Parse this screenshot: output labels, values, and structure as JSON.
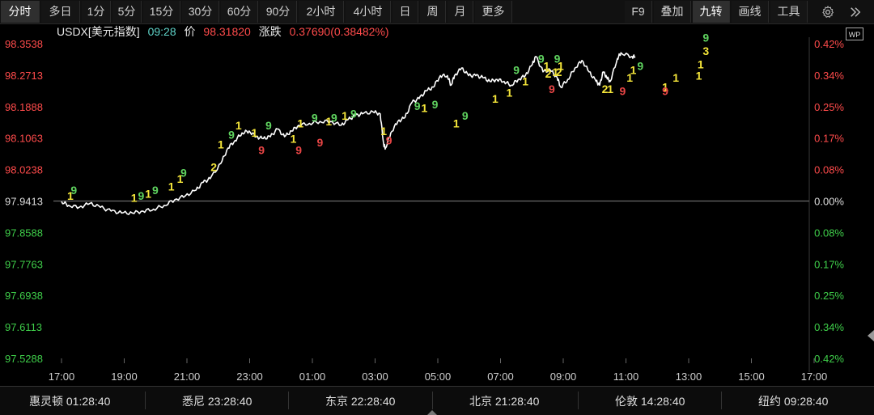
{
  "toolbar": {
    "periods": [
      {
        "label": "分时",
        "active": true
      },
      {
        "label": "多日",
        "active": false
      },
      {
        "label": "1分",
        "active": false
      },
      {
        "label": "5分",
        "active": false
      },
      {
        "label": "15分",
        "active": false
      },
      {
        "label": "30分",
        "active": false
      },
      {
        "label": "60分",
        "active": false
      },
      {
        "label": "90分",
        "active": false
      },
      {
        "label": "2小时",
        "active": false
      },
      {
        "label": "4小时",
        "active": false
      },
      {
        "label": "日",
        "active": false
      },
      {
        "label": "周",
        "active": false
      },
      {
        "label": "月",
        "active": false
      },
      {
        "label": "更多",
        "active": false
      }
    ],
    "tools": [
      {
        "label": "F9",
        "active": false
      },
      {
        "label": "叠加",
        "active": false
      },
      {
        "label": "九转",
        "active": true
      },
      {
        "label": "画线",
        "active": false
      },
      {
        "label": "工具",
        "active": false
      }
    ],
    "settings_icon": "gear-icon",
    "expand_icon": "double-chevron-right-icon"
  },
  "info": {
    "symbol": "USDX[美元指数]",
    "time": "09:28",
    "price_label": "价",
    "price": "98.31820",
    "change_label": "涨跌",
    "change": "0.37690(0.38482%)",
    "wp_badge": "WP"
  },
  "colors": {
    "up": "#ff3b30",
    "down": "#3fcf4a",
    "line": "#ffffff",
    "nine_yellow": "#f5e63a",
    "nine_green": "#5fd35f",
    "nine_red": "#e84545",
    "base": "#6a6a6a"
  },
  "chart_data": {
    "type": "line",
    "title": "USDX[美元指数]",
    "base_price": 97.9413,
    "y_ticks_left": [
      "98.3538",
      "98.2713",
      "98.1888",
      "98.1063",
      "98.0238",
      "97.9413",
      "97.8588",
      "97.7763",
      "97.6938",
      "97.6113",
      "97.5288"
    ],
    "y_ticks_right": [
      "0.42%",
      "0.34%",
      "0.25%",
      "0.17%",
      "0.08%",
      "0.00%",
      "0.08%",
      "0.17%",
      "0.25%",
      "0.34%",
      "0.42%"
    ],
    "ylim": [
      97.5288,
      98.3538
    ],
    "x_ticks": [
      "17:00",
      "19:00",
      "21:00",
      "23:00",
      "01:00",
      "03:00",
      "05:00",
      "07:00",
      "09:00",
      "11:00",
      "13:00",
      "15:00",
      "17:00"
    ],
    "x_range_hours": [
      0,
      24
    ],
    "series": [
      {
        "points": [
          [
            0,
            97.94
          ],
          [
            0.2,
            97.93
          ],
          [
            0.5,
            97.925
          ],
          [
            0.8,
            97.935
          ],
          [
            1.1,
            97.925
          ],
          [
            1.4,
            97.915
          ],
          [
            1.7,
            97.91
          ],
          [
            2.0,
            97.91
          ],
          [
            2.3,
            97.915
          ],
          [
            2.6,
            97.92
          ],
          [
            2.9,
            97.93
          ],
          [
            3.2,
            97.945
          ],
          [
            3.5,
            97.955
          ],
          [
            3.8,
            97.97
          ],
          [
            4.0,
            97.99
          ],
          [
            4.2,
            98.0
          ],
          [
            4.5,
            98.04
          ],
          [
            4.7,
            98.08
          ],
          [
            4.9,
            98.1
          ],
          [
            5.1,
            98.12
          ],
          [
            5.3,
            98.125
          ],
          [
            5.5,
            98.11
          ],
          [
            5.7,
            98.105
          ],
          [
            5.9,
            98.11
          ],
          [
            6.1,
            98.13
          ],
          [
            6.3,
            98.11
          ],
          [
            6.5,
            98.125
          ],
          [
            6.7,
            98.14
          ],
          [
            7.0,
            98.145
          ],
          [
            7.3,
            98.15
          ],
          [
            7.6,
            98.15
          ],
          [
            7.9,
            98.14
          ],
          [
            8.1,
            98.155
          ],
          [
            8.3,
            98.165
          ],
          [
            8.5,
            98.17
          ],
          [
            8.8,
            98.175
          ],
          [
            9.0,
            98.17
          ],
          [
            9.1,
            98.09
          ],
          [
            9.15,
            98.08
          ],
          [
            9.3,
            98.12
          ],
          [
            9.5,
            98.15
          ],
          [
            9.7,
            98.16
          ],
          [
            9.9,
            98.2
          ],
          [
            10.1,
            98.21
          ],
          [
            10.3,
            98.23
          ],
          [
            10.5,
            98.24
          ],
          [
            10.7,
            98.27
          ],
          [
            10.9,
            98.27
          ],
          [
            11.0,
            98.245
          ],
          [
            11.1,
            98.27
          ],
          [
            11.3,
            98.29
          ],
          [
            11.5,
            98.27
          ],
          [
            11.7,
            98.27
          ],
          [
            11.9,
            98.265
          ],
          [
            12.1,
            98.255
          ],
          [
            12.3,
            98.26
          ],
          [
            12.5,
            98.255
          ],
          [
            12.7,
            98.245
          ],
          [
            12.9,
            98.26
          ],
          [
            13.1,
            98.27
          ],
          [
            13.3,
            98.3
          ],
          [
            13.4,
            98.32
          ],
          [
            13.6,
            98.28
          ],
          [
            13.8,
            98.285
          ],
          [
            14.0,
            98.265
          ],
          [
            14.1,
            98.24
          ],
          [
            14.3,
            98.26
          ],
          [
            14.5,
            98.29
          ],
          [
            14.7,
            98.31
          ],
          [
            14.9,
            98.28
          ],
          [
            15.1,
            98.255
          ],
          [
            15.2,
            98.245
          ],
          [
            15.3,
            98.28
          ],
          [
            15.4,
            98.265
          ],
          [
            15.5,
            98.255
          ],
          [
            15.7,
            98.315
          ],
          [
            15.8,
            98.33
          ],
          [
            16.1,
            98.32
          ],
          [
            16.2,
            98.32
          ]
        ]
      }
    ],
    "markers": [
      {
        "t": 0.35,
        "v": 97.97,
        "text": "9",
        "color": "green"
      },
      {
        "t": 0.25,
        "v": 97.955,
        "text": "1",
        "color": "yellow"
      },
      {
        "t": 2.05,
        "v": 97.95,
        "text": "1",
        "color": "yellow"
      },
      {
        "t": 2.25,
        "v": 97.955,
        "text": "9",
        "color": "green"
      },
      {
        "t": 2.65,
        "v": 97.97,
        "text": "9",
        "color": "green"
      },
      {
        "t": 2.45,
        "v": 97.96,
        "text": "1",
        "color": "yellow"
      },
      {
        "t": 3.1,
        "v": 97.98,
        "text": "1",
        "color": "yellow"
      },
      {
        "t": 3.45,
        "v": 98.015,
        "text": "9",
        "color": "green"
      },
      {
        "t": 3.35,
        "v": 98.0,
        "text": "1",
        "color": "yellow"
      },
      {
        "t": 4.3,
        "v": 98.03,
        "text": "2",
        "color": "yellow"
      },
      {
        "t": 4.5,
        "v": 98.09,
        "text": "1",
        "color": "yellow"
      },
      {
        "t": 4.8,
        "v": 98.115,
        "text": "9",
        "color": "green"
      },
      {
        "t": 5.0,
        "v": 98.14,
        "text": "1",
        "color": "yellow"
      },
      {
        "t": 5.45,
        "v": 98.12,
        "text": "1",
        "color": "yellow"
      },
      {
        "t": 5.65,
        "v": 98.075,
        "text": "9",
        "color": "red"
      },
      {
        "t": 5.85,
        "v": 98.14,
        "text": "9",
        "color": "green"
      },
      {
        "t": 6.55,
        "v": 98.105,
        "text": "1",
        "color": "yellow"
      },
      {
        "t": 6.7,
        "v": 98.075,
        "text": "9",
        "color": "red"
      },
      {
        "t": 6.75,
        "v": 98.145,
        "text": "1",
        "color": "yellow"
      },
      {
        "t": 7.15,
        "v": 98.16,
        "text": "9",
        "color": "green"
      },
      {
        "t": 7.3,
        "v": 98.095,
        "text": "9",
        "color": "red"
      },
      {
        "t": 7.55,
        "v": 98.15,
        "text": "1",
        "color": "yellow"
      },
      {
        "t": 7.7,
        "v": 98.16,
        "text": "9",
        "color": "green"
      },
      {
        "t": 8.0,
        "v": 98.165,
        "text": "1",
        "color": "yellow"
      },
      {
        "t": 8.25,
        "v": 98.17,
        "text": "9",
        "color": "green"
      },
      {
        "t": 9.25,
        "v": 98.1,
        "text": "9",
        "color": "red"
      },
      {
        "t": 9.1,
        "v": 98.125,
        "text": "1",
        "color": "yellow"
      },
      {
        "t": 10.05,
        "v": 98.19,
        "text": "9",
        "color": "green"
      },
      {
        "t": 10.25,
        "v": 98.185,
        "text": "1",
        "color": "yellow"
      },
      {
        "t": 10.55,
        "v": 98.195,
        "text": "9",
        "color": "green"
      },
      {
        "t": 11.15,
        "v": 98.145,
        "text": "1",
        "color": "yellow"
      },
      {
        "t": 11.4,
        "v": 98.165,
        "text": "9",
        "color": "green"
      },
      {
        "t": 12.25,
        "v": 98.21,
        "text": "1",
        "color": "yellow"
      },
      {
        "t": 12.65,
        "v": 98.225,
        "text": "1",
        "color": "yellow"
      },
      {
        "t": 12.85,
        "v": 98.285,
        "text": "9",
        "color": "green"
      },
      {
        "t": 13.1,
        "v": 98.255,
        "text": "1",
        "color": "yellow"
      },
      {
        "t": 13.55,
        "v": 98.315,
        "text": "9",
        "color": "green"
      },
      {
        "t": 13.7,
        "v": 98.295,
        "text": "1",
        "color": "yellow"
      },
      {
        "t": 13.75,
        "v": 98.275,
        "text": "2",
        "color": "yellow"
      },
      {
        "t": 13.95,
        "v": 98.28,
        "text": "1",
        "color": "yellow"
      },
      {
        "t": 14.0,
        "v": 98.315,
        "text": "9",
        "color": "green"
      },
      {
        "t": 14.05,
        "v": 98.28,
        "text": "2",
        "color": "yellow"
      },
      {
        "t": 14.1,
        "v": 98.295,
        "text": "1",
        "color": "yellow"
      },
      {
        "t": 13.85,
        "v": 98.235,
        "text": "9",
        "color": "red"
      },
      {
        "t": 15.35,
        "v": 98.235,
        "text": "2",
        "color": "yellow"
      },
      {
        "t": 15.5,
        "v": 98.235,
        "text": "1",
        "color": "yellow"
      },
      {
        "t": 15.85,
        "v": 98.23,
        "text": "9",
        "color": "red"
      },
      {
        "t": 16.05,
        "v": 98.265,
        "text": "1",
        "color": "yellow"
      },
      {
        "t": 16.15,
        "v": 98.285,
        "text": "1",
        "color": "yellow"
      },
      {
        "t": 16.35,
        "v": 98.295,
        "text": "9",
        "color": "green"
      },
      {
        "t": 17.05,
        "v": 98.24,
        "text": "1",
        "color": "yellow"
      },
      {
        "t": 17.05,
        "v": 98.23,
        "text": "9",
        "color": "red"
      },
      {
        "t": 17.35,
        "v": 98.265,
        "text": "1",
        "color": "yellow"
      },
      {
        "t": 18.0,
        "v": 98.27,
        "text": "1",
        "color": "yellow"
      },
      {
        "t": 18.2,
        "v": 98.335,
        "text": "3",
        "color": "yellow"
      },
      {
        "t": 18.2,
        "v": 98.37,
        "text": "9",
        "color": "green"
      },
      {
        "t": 18.05,
        "v": 98.3,
        "text": "1",
        "color": "yellow"
      }
    ]
  },
  "timezones": [
    {
      "city": "惠灵顿",
      "time": "01:28:40"
    },
    {
      "city": "悉尼",
      "time": "23:28:40"
    },
    {
      "city": "东京",
      "time": "22:28:40"
    },
    {
      "city": "北京",
      "time": "21:28:40"
    },
    {
      "city": "伦敦",
      "time": "14:28:40"
    },
    {
      "city": "纽约",
      "time": "09:28:40"
    }
  ]
}
